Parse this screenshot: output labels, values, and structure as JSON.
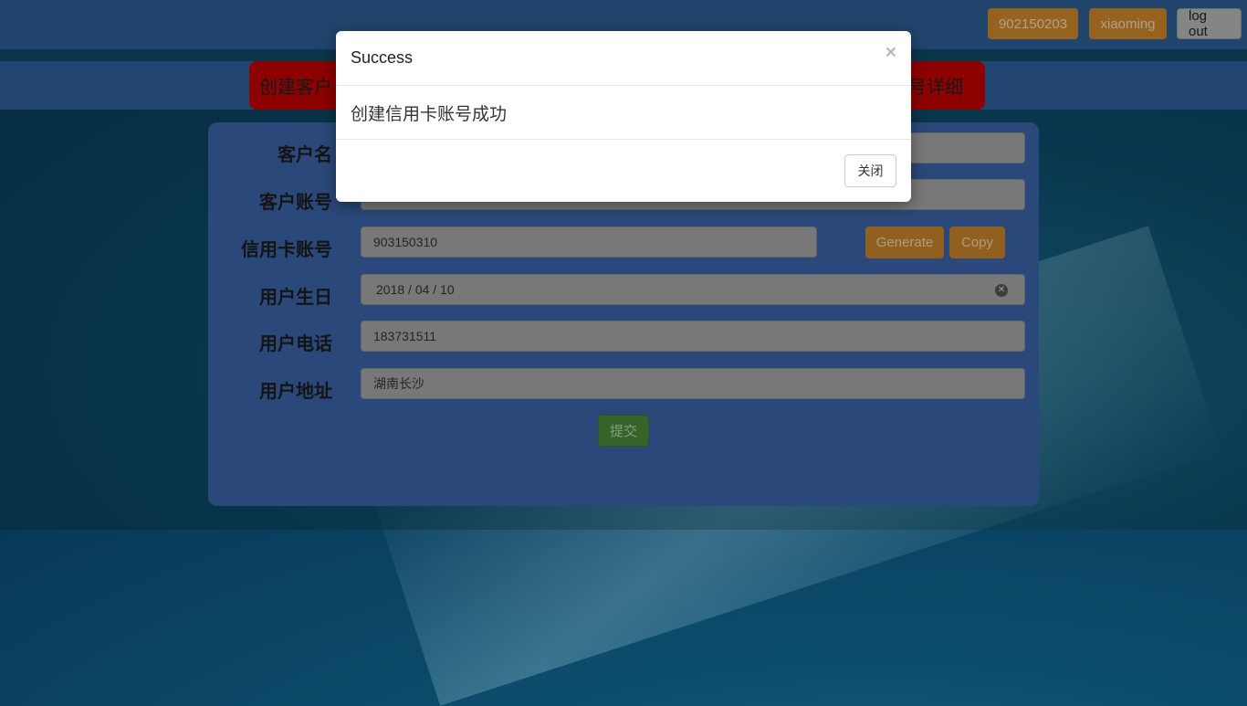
{
  "topbar": {
    "account_id": "902150203",
    "username": "xiaoming",
    "logout_label": "log out"
  },
  "nav": {
    "left_label": "创建客户",
    "right_label": "号详细"
  },
  "form": {
    "customer_name_label": "客户名",
    "customer_account_label": "客户账号",
    "credit_card_label": "信用卡账号",
    "credit_card_value": "903150310",
    "generate_label": "Generate",
    "copy_label": "Copy",
    "birthday_label": "用户生日",
    "birthday_value": "2018 / 04 / 10",
    "phone_label": "用户电话",
    "phone_value": "183731511",
    "address_label": "用户地址",
    "address_value": "湖南长沙",
    "submit_label": "提交"
  },
  "modal": {
    "title": "Success",
    "close_symbol": "×",
    "message": "创建信用卡账号成功",
    "close_button_label": "关闭"
  }
}
